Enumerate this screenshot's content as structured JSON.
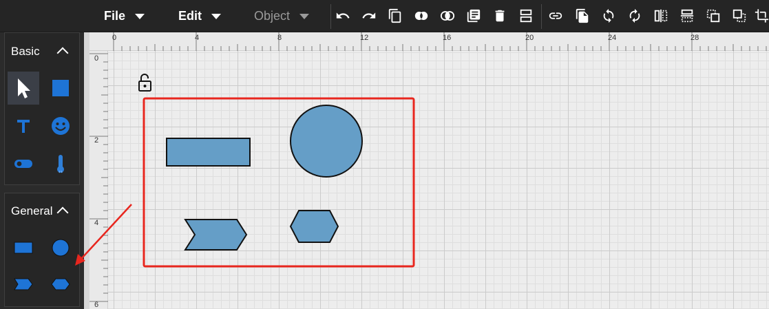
{
  "menubar": {
    "file": "File",
    "edit": "Edit",
    "object": "Object"
  },
  "toolbar_icons": [
    "undo-icon",
    "redo-icon",
    "copy-icon",
    "union-icon",
    "intersect-icon",
    "paste-icon",
    "delete-icon",
    "align-icon",
    "link-icon",
    "duplicate-icon",
    "rotate-cw-icon",
    "rotate-ccw-icon",
    "flip-horizontal-icon",
    "flip-vertical-icon",
    "bring-front-icon",
    "send-back-icon",
    "crop-icon"
  ],
  "panel": {
    "basic": {
      "title": "Basic",
      "tools": [
        "pointer-tool",
        "rectangle-tool",
        "text-tool",
        "emoji-tool",
        "toggle-tool",
        "thermometer-tool"
      ]
    },
    "general": {
      "title": "General",
      "tools": [
        "rectangle-shape",
        "circle-shape",
        "chevron-shape",
        "hexagon-shape"
      ]
    }
  },
  "rulers": {
    "top": [
      "0",
      "4",
      "8",
      "12",
      "16",
      "20",
      "24",
      "28"
    ],
    "left": [
      "0",
      "2",
      "4",
      "6"
    ]
  },
  "colors": {
    "shape_fill": "#659ec7",
    "shape_stroke": "#111111",
    "selection_box": "#e8261e",
    "annotation_arrow": "#e8261e",
    "panel_icon": "#1e74d6"
  }
}
